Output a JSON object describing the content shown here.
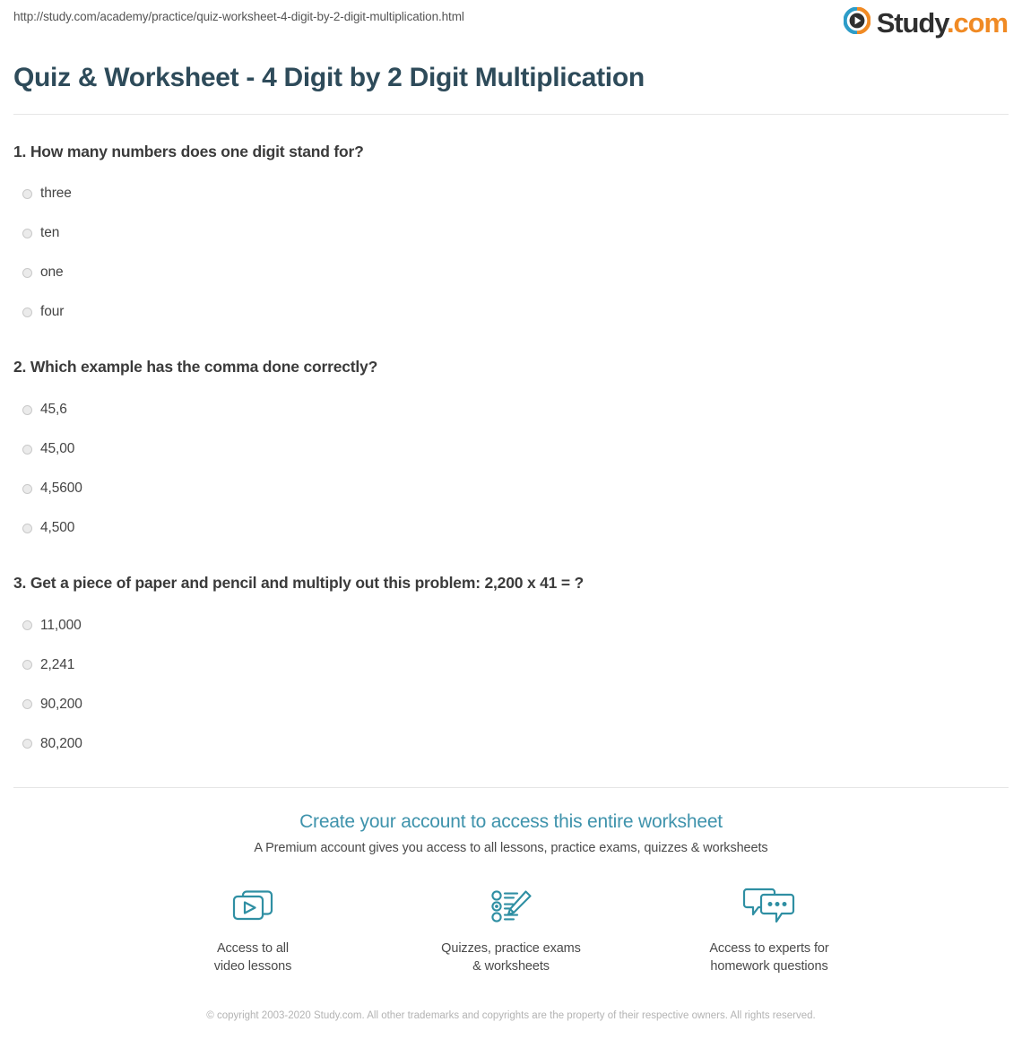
{
  "header": {
    "url": "http://study.com/academy/practice/quiz-worksheet-4-digit-by-2-digit-multiplication.html",
    "brand_name": "Study",
    "brand_suffix": ".com",
    "logo_icon": "play-circle-icon",
    "accent_blue": "#2d9cc8",
    "accent_orange": "#f08a24"
  },
  "title": "Quiz & Worksheet - 4 Digit by 2 Digit Multiplication",
  "questions": [
    {
      "number": "1.",
      "text": "1. How many numbers does one digit stand for?",
      "options": [
        "three",
        "ten",
        "one",
        "four"
      ]
    },
    {
      "number": "2.",
      "text": "2. Which example has the comma done correctly?",
      "options": [
        "45,6",
        "45,00",
        "4,5600",
        "4,500"
      ]
    },
    {
      "number": "3.",
      "text": "3. Get a piece of paper and pencil and multiply out this problem: 2,200 x 41 = ?",
      "options": [
        "11,000",
        "2,241",
        "90,200",
        "80,200"
      ]
    }
  ],
  "promo": {
    "headline": "Create your account to access this entire worksheet",
    "subtext": "A Premium account gives you access to all lessons, practice exams, quizzes & worksheets",
    "accent_color": "#3f93ac",
    "icon_color": "#2f8fa3",
    "features": [
      {
        "icon": "video-lessons-icon",
        "label": "Access to all\nvideo lessons"
      },
      {
        "icon": "quiz-pencil-icon",
        "label": "Quizzes, practice exams\n& worksheets"
      },
      {
        "icon": "chat-bubbles-icon",
        "label": "Access to experts for\nhomework questions"
      }
    ]
  },
  "copyright": "© copyright 2003-2020 Study.com. All other trademarks and copyrights are the property of their respective owners. All rights reserved."
}
